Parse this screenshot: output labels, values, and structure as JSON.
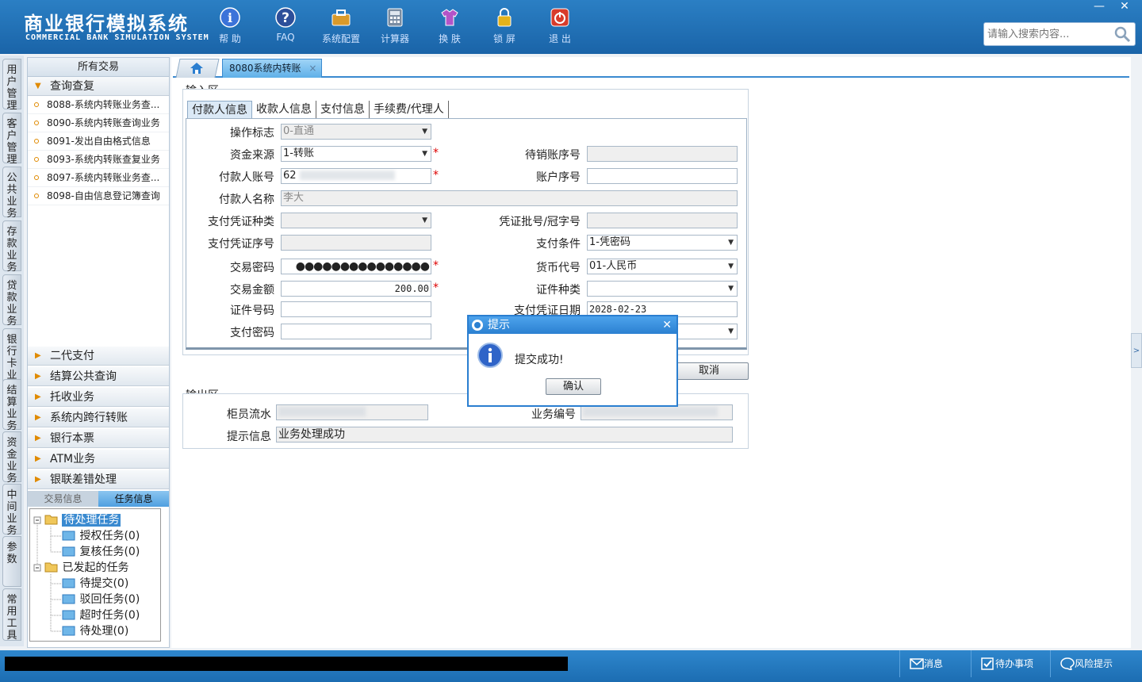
{
  "app": {
    "title_cn": "商业银行模拟系统",
    "title_en": "COMMERCIAL BANK SIMULATION SYSTEM"
  },
  "toolbar": [
    {
      "label": "帮 助",
      "icon": "help-icon"
    },
    {
      "label": "FAQ",
      "icon": "faq-icon"
    },
    {
      "label": "系统配置",
      "icon": "toolbox-icon"
    },
    {
      "label": "计算器",
      "icon": "calculator-icon"
    },
    {
      "label": "换 肤",
      "icon": "skin-icon"
    },
    {
      "label": "锁 屏",
      "icon": "lock-icon"
    },
    {
      "label": "退 出",
      "icon": "power-icon"
    }
  ],
  "window": {
    "minimize": "—",
    "close": "✕"
  },
  "search": {
    "placeholder": "请输入搜索内容..."
  },
  "vtabs": [
    "用户管理",
    "客户管理",
    "公共业务",
    "存款业务",
    "贷款业务",
    "银行卡业务",
    "结算业务",
    "资金业务",
    "中间业务",
    "参数",
    "常用工具"
  ],
  "left": {
    "header": "所有交易",
    "open_section": "查询查复",
    "open_items": [
      "8088-系统内转账业务查...",
      "8090-系统内转账查询业务",
      "8091-发出自由格式信息",
      "8093-系统内转账查复业务",
      "8097-系统内转账业务查...",
      "8098-自由信息登记簿查询"
    ],
    "sections": [
      "二代支付",
      "结算公共查询",
      "托收业务",
      "系统内跨行转账",
      "银行本票",
      "ATM业务",
      "银联差错处理"
    ],
    "task_tabs": [
      "交易信息",
      "任务信息"
    ],
    "tree": {
      "pending": "待处理任务",
      "pending_children": [
        "授权任务(0)",
        "复核任务(0)"
      ],
      "initiated": "已发起的任务",
      "initiated_children": [
        "待提交(0)",
        "驳回任务(0)",
        "超时任务(0)",
        "待处理(0)"
      ]
    }
  },
  "tabs": {
    "active": "8080系统内转账",
    "close": "×"
  },
  "input_area": {
    "title": "输入区",
    "subtabs": [
      "付款人信息",
      "收款人信息",
      "支付信息",
      "手续费/代理人"
    ],
    "fields": {
      "op_flag": {
        "label": "操作标志",
        "value": "0-直通"
      },
      "fund_source": {
        "label": "资金来源",
        "value": "1-转账"
      },
      "pending_seq": {
        "label": "待销账序号",
        "value": ""
      },
      "payer_account": {
        "label": "付款人账号",
        "value": "62"
      },
      "account_seq": {
        "label": "账户序号",
        "value": ""
      },
      "payer_name": {
        "label": "付款人名称",
        "value": "李大"
      },
      "voucher_type": {
        "label": "支付凭证种类",
        "value": ""
      },
      "voucher_batch": {
        "label": "凭证批号/冠字号",
        "value": ""
      },
      "voucher_no": {
        "label": "支付凭证序号",
        "value": ""
      },
      "pay_condition": {
        "label": "支付条件",
        "value": "1-凭密码"
      },
      "trade_pwd": {
        "label": "交易密码",
        "value": "●●●●●●●●●●●●●●●"
      },
      "currency": {
        "label": "货币代号",
        "value": "01-人民币"
      },
      "amount": {
        "label": "交易金额",
        "value": "200.00"
      },
      "id_type": {
        "label": "证件种类",
        "value": ""
      },
      "id_no": {
        "label": "证件号码",
        "value": ""
      },
      "voucher_date": {
        "label": "支付凭证日期",
        "value": "2028-02-23"
      },
      "pay_pwd": {
        "label": "支付密码",
        "value": ""
      }
    },
    "required_mark": "*",
    "cancel_label": "取消"
  },
  "output_area": {
    "title": "输出区",
    "teller_serial": {
      "label": "柜员流水",
      "value": ""
    },
    "business_no": {
      "label": "业务编号",
      "value": ""
    },
    "message": {
      "label": "提示信息",
      "value": "业务处理成功"
    }
  },
  "dialog": {
    "title": "提示",
    "message": "提交成功!",
    "ok_label": "确认",
    "close": "✕"
  },
  "statusbar": {
    "items": [
      "消息",
      "待办事项",
      "风险提示"
    ]
  },
  "colors": {
    "header_blue": "#1a64a8",
    "accent": "#2a7ed0",
    "required": "#dd0000"
  }
}
